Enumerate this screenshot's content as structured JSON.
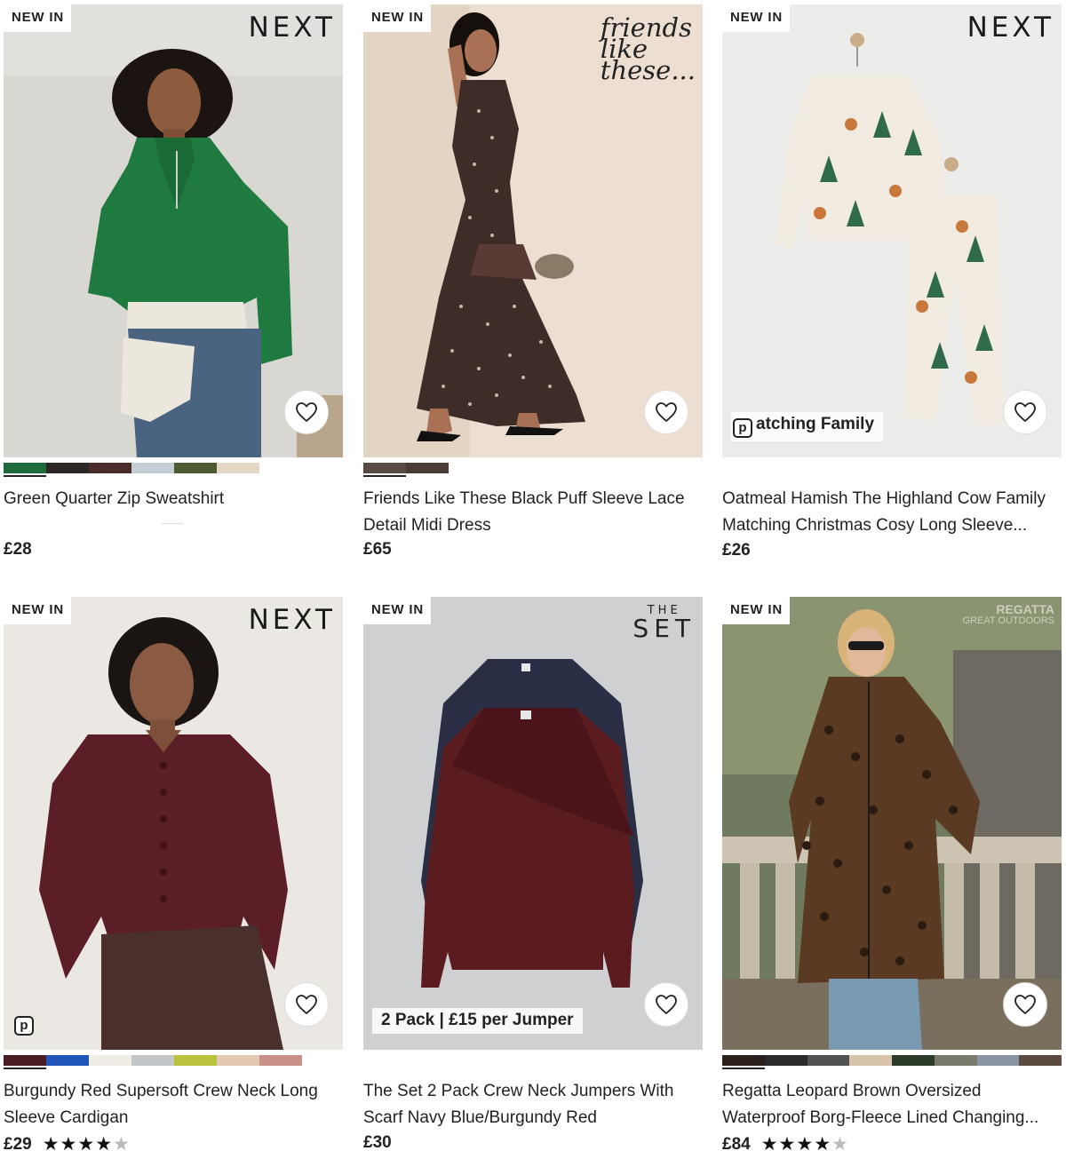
{
  "products": [
    {
      "badge": "NEW IN",
      "brand": "NEXT",
      "title": "Green Quarter Zip Sweatshirt",
      "price": "£28",
      "swatches": [
        "#1e6b3c",
        "#2b2623",
        "#4a2d28",
        "#c4cdd3",
        "#4e5a32",
        "#e6d8c6"
      ],
      "image": "green-quarter-zip-model"
    },
    {
      "badge": "NEW IN",
      "brand_lines": [
        "friends",
        "like",
        "these..."
      ],
      "title_line1": "Friends Like These Black Puff Sleeve Lace",
      "title_line2": "Detail Midi Dress",
      "price": "£65",
      "swatches": [
        "#5a4a44",
        "#4a3b35"
      ],
      "image": "black-midi-dress-model"
    },
    {
      "badge": "NEW IN",
      "brand": "NEXT",
      "overlay": "atching Family",
      "title_line1": "Oatmeal Hamish The Highland Cow Family",
      "title_line2": "Matching Christmas Cosy Long Sleeve...",
      "price": "£26",
      "image": "christmas-pyjamas-hanger"
    },
    {
      "badge": "NEW IN",
      "brand": "NEXT",
      "title_line1": "Burgundy Red Supersoft Crew Neck Long",
      "title_line2": "Sleeve Cardigan",
      "price": "£29",
      "rating": 4.5,
      "swatches": [
        "#4a1d22",
        "#1f56b8",
        "#f0ede6",
        "#c3c6c9",
        "#b8c23a",
        "#e4c7b0",
        "#c99088"
      ],
      "image": "burgundy-cardigan-model"
    },
    {
      "badge": "NEW IN",
      "brand_small": "THE",
      "brand": "SET",
      "overlay": "2 Pack | £15 per Jumper",
      "title_line1": "The Set 2 Pack Crew Neck Jumpers With",
      "title_line2": "Scarf Navy Blue/Burgundy Red",
      "price": "£30",
      "image": "two-pack-jumpers-hanging"
    },
    {
      "badge": "NEW IN",
      "brand": "REGATTA",
      "brand_small": "GREAT OUTDOORS",
      "title_line1": "Regatta Leopard Brown Oversized",
      "title_line2": "Waterproof Borg-Fleece Lined Changing...",
      "price": "£84",
      "rating": 4.5,
      "swatches": [
        "#2a1f1a",
        "#2a2a2a",
        "#50524f",
        "#d8c4ac",
        "#2c3a2a",
        "#7a7a6c",
        "#8a94a2",
        "#5a4a40"
      ],
      "image": "leopard-robe-model"
    }
  ],
  "icons": {
    "favourite": "heart-outline-icon",
    "rating": "star-icon",
    "personalise": "p-badge-icon"
  },
  "accent": "#1a1a1a"
}
